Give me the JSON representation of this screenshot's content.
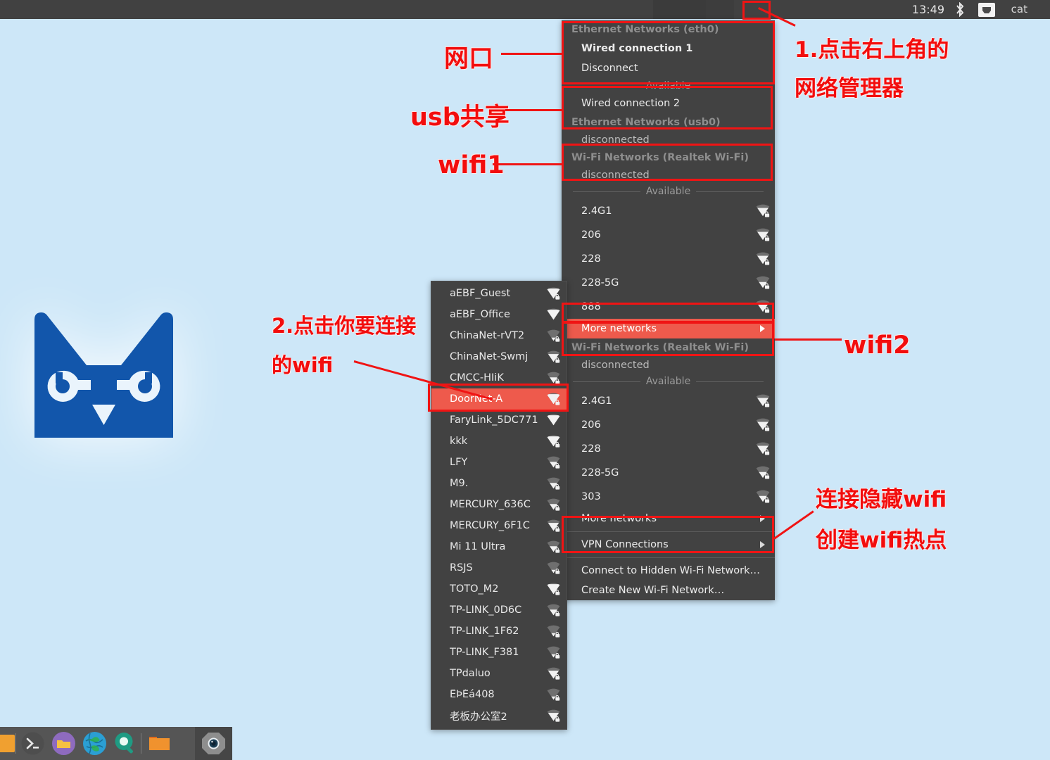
{
  "topbar": {
    "clock": "13:49",
    "user": "cat",
    "icons": [
      "bluetooth-icon",
      "network-wired-icon"
    ]
  },
  "desktop": {
    "logo_name": "blue-cat-wrench-logo"
  },
  "network_menu": {
    "sections": [
      {
        "header": "Ethernet Networks (eth0)",
        "type": "ethernet",
        "items": [
          {
            "label": "Wired connection 1",
            "bold": true
          },
          {
            "label": "Disconnect",
            "bold": false
          }
        ],
        "available_label": "Available",
        "available_items": [
          {
            "label": "Wired connection 2"
          }
        ]
      },
      {
        "header": "Ethernet Networks (usb0)",
        "type": "ethernet",
        "status": "disconnected"
      },
      {
        "header": "Wi-Fi Networks (Realtek Wi-Fi)",
        "type": "wifi",
        "status": "disconnected",
        "available_label": "Available",
        "networks": [
          {
            "ssid": "2.4G1",
            "signal": 3,
            "secure": true
          },
          {
            "ssid": "206",
            "signal": 3,
            "secure": true
          },
          {
            "ssid": "228",
            "signal": 3,
            "secure": true
          },
          {
            "ssid": "228-5G",
            "signal": 2,
            "secure": true
          },
          {
            "ssid": "888",
            "signal": 3,
            "secure": true
          }
        ],
        "more_label": "More networks",
        "more_highlighted": true
      },
      {
        "header": "Wi-Fi Networks (Realtek Wi-Fi)",
        "type": "wifi",
        "status": "disconnected",
        "available_label": "Available",
        "networks": [
          {
            "ssid": "2.4G1",
            "signal": 3,
            "secure": true
          },
          {
            "ssid": "206",
            "signal": 3,
            "secure": true
          },
          {
            "ssid": "228",
            "signal": 3,
            "secure": true
          },
          {
            "ssid": "228-5G",
            "signal": 2,
            "secure": true
          },
          {
            "ssid": "303",
            "signal": 2,
            "secure": true
          }
        ],
        "more_label": "More networks",
        "more_highlighted": false
      }
    ],
    "vpn_label": "VPN Connections",
    "hidden_label": "Connect to Hidden Wi-Fi Network…",
    "create_label": "Create New Wi-Fi Network…"
  },
  "submenu": {
    "items": [
      {
        "ssid": "aEBF_Guest",
        "signal": 4,
        "secure": true
      },
      {
        "ssid": "aEBF_Office",
        "signal": 4,
        "secure": false
      },
      {
        "ssid": "ChinaNet-rVT2",
        "signal": 1,
        "secure": true
      },
      {
        "ssid": "ChinaNet-Swmj",
        "signal": 3,
        "secure": true
      },
      {
        "ssid": "CMCC-HIiK",
        "signal": 2,
        "secure": true
      },
      {
        "ssid": "DoorNet-A",
        "signal": 4,
        "secure": true,
        "highlighted": true
      },
      {
        "ssid": "FaryLink_5DC771",
        "signal": 4,
        "secure": false
      },
      {
        "ssid": "kkk",
        "signal": 4,
        "secure": true
      },
      {
        "ssid": "LFY",
        "signal": 2,
        "secure": true
      },
      {
        "ssid": "M9.",
        "signal": 2,
        "secure": true
      },
      {
        "ssid": "MERCURY_636C",
        "signal": 2,
        "secure": true
      },
      {
        "ssid": "MERCURY_6F1C",
        "signal": 3,
        "secure": true
      },
      {
        "ssid": "Mi 11 Ultra",
        "signal": 2,
        "secure": true
      },
      {
        "ssid": "RSJS",
        "signal": 1,
        "secure": true
      },
      {
        "ssid": "TOTO_M2",
        "signal": 4,
        "secure": true
      },
      {
        "ssid": "TP-LINK_0D6C",
        "signal": 2,
        "secure": true
      },
      {
        "ssid": "TP-LINK_1F62",
        "signal": 1,
        "secure": true
      },
      {
        "ssid": "TP-LINK_F381",
        "signal": 1,
        "secure": true
      },
      {
        "ssid": "TPdaluo",
        "signal": 3,
        "secure": true
      },
      {
        "ssid": "ËÞÉá408",
        "signal": 1,
        "secure": true
      },
      {
        "ssid": "老板办公室2",
        "signal": 3,
        "secure": true
      }
    ]
  },
  "annotations": {
    "color": "#f20d0d",
    "labels": [
      {
        "id": "wangkou",
        "text": "网口"
      },
      {
        "id": "usb-share",
        "text": "usb共享"
      },
      {
        "id": "wifi1",
        "text": "wifi1"
      },
      {
        "id": "wifi2",
        "text": "wifi2"
      },
      {
        "id": "step1",
        "text": "1.点击右上角的"
      },
      {
        "id": "step1b",
        "text": "网络管理器"
      },
      {
        "id": "step2",
        "text": "2.点击你要连接"
      },
      {
        "id": "step2b",
        "text": "的wifi"
      },
      {
        "id": "hidden-wifi",
        "text": "连接隐藏wifi"
      },
      {
        "id": "create-hotspot",
        "text": "创建wifi热点"
      }
    ]
  },
  "taskbar": {
    "items": [
      {
        "name": "app-orange-square-icon"
      },
      {
        "name": "terminal-icon"
      },
      {
        "name": "file-manager-purple-icon"
      },
      {
        "name": "web-browser-globe-icon"
      },
      {
        "name": "search-magnifier-icon"
      },
      {
        "name": "folder-orange-icon"
      },
      {
        "name": "camera-shutter-icon"
      }
    ]
  }
}
